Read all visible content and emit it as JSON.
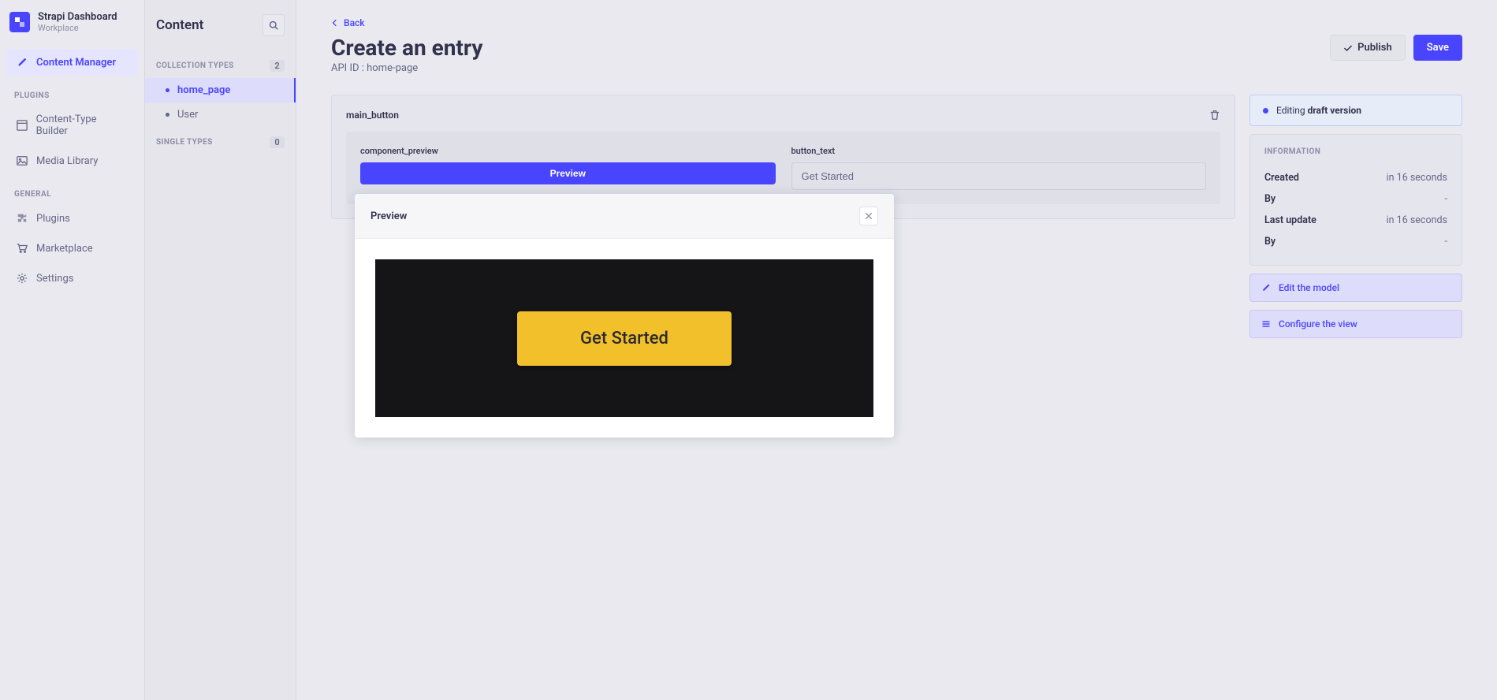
{
  "brand": {
    "title": "Strapi Dashboard",
    "sub": "Workplace"
  },
  "nav1": {
    "content_manager": "Content Manager",
    "section_plugins": "PLUGINS",
    "content_type_builder": "Content-Type Builder",
    "media_library": "Media Library",
    "section_general": "GENERAL",
    "plugins": "Plugins",
    "marketplace": "Marketplace",
    "settings": "Settings"
  },
  "nav2": {
    "title": "Content",
    "collection_section": "COLLECTION TYPES",
    "collection_count": "2",
    "items": [
      {
        "label": "home_page",
        "active": true
      },
      {
        "label": "User",
        "active": false
      }
    ],
    "single_section": "SINGLE TYPES",
    "single_count": "0"
  },
  "header": {
    "back": "Back",
    "title": "Create an entry",
    "api_id": "API ID : home-page",
    "publish": "Publish",
    "save": "Save"
  },
  "component": {
    "name": "main_button",
    "field_preview_label": "component_preview",
    "preview_btn": "Preview",
    "field_text_label": "button_text",
    "field_text_value": "Get Started"
  },
  "aside": {
    "editing_pre": "Editing ",
    "editing_strong": "draft version",
    "info_title": "INFORMATION",
    "rows": [
      {
        "k": "Created",
        "v": "in 16 seconds"
      },
      {
        "k": "By",
        "v": "-"
      },
      {
        "k": "Last update",
        "v": "in 16 seconds"
      },
      {
        "k": "By",
        "v": "-"
      }
    ],
    "edit_model": "Edit the model",
    "configure_view": "Configure the view"
  },
  "modal": {
    "title": "Preview",
    "button_text": "Get Started"
  }
}
